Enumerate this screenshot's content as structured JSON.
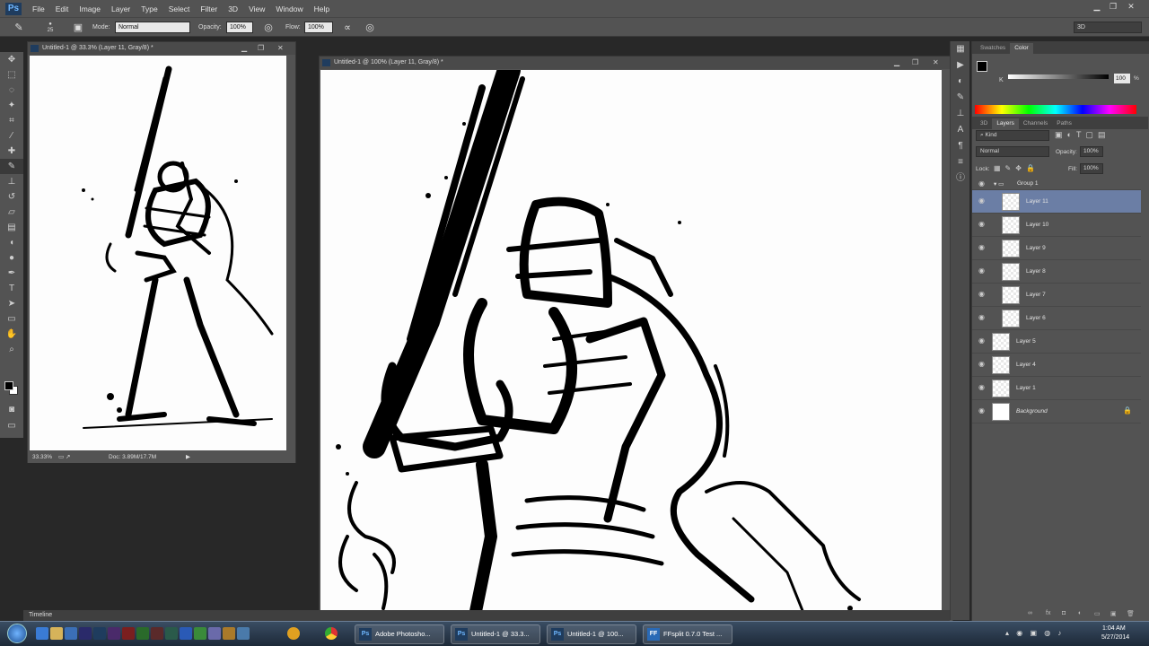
{
  "app": {
    "logo": "Ps",
    "menus": [
      "File",
      "Edit",
      "Image",
      "Layer",
      "Type",
      "Select",
      "Filter",
      "3D",
      "View",
      "Window",
      "Help"
    ],
    "workspace": "3D"
  },
  "options": {
    "brush_size": "25",
    "mode_label": "Mode:",
    "mode_value": "Normal",
    "opacity_label": "Opacity:",
    "opacity_value": "100%",
    "flow_label": "Flow:",
    "flow_value": "100%"
  },
  "doc_small": {
    "title": "Untitled-1 @ 33.3% (Layer 11, Gray/8) *",
    "zoom": "33.33%",
    "doc_info": "Doc: 3.89M/17.7M"
  },
  "doc_large": {
    "title": "Untitled-1 @ 100% (Layer 11, Gray/8) *"
  },
  "color_panel": {
    "tabs": [
      "Swatches",
      "Color"
    ],
    "channel": "K",
    "value": "100",
    "value_unit": "%"
  },
  "layers_panel": {
    "tabs": [
      "3D",
      "Layers",
      "Channels",
      "Paths"
    ],
    "filter": "Kind",
    "blend": "Normal",
    "opacity_label": "Opacity:",
    "opacity": "100%",
    "lock_label": "Lock:",
    "fill_label": "Fill:",
    "fill": "100%",
    "group": "Group 1",
    "layers": [
      "Layer 11",
      "Layer 10",
      "Layer 9",
      "Layer 8",
      "Layer 7",
      "Layer 6",
      "Layer 5",
      "Layer 4",
      "Layer 1",
      "Background"
    ]
  },
  "timeline": "Timeline",
  "taskbar": {
    "tasks": [
      "Adobe Photosho...",
      "Untitled-1 @ 33.3...",
      "Untitled-1 @ 100...",
      "FFsplit 0.7.0 Test ..."
    ],
    "time": "1:04 AM",
    "date": "5/27/2014"
  },
  "colors": {
    "ui": "#535353",
    "dark": "#282828",
    "selected": "#6b7ea5"
  }
}
